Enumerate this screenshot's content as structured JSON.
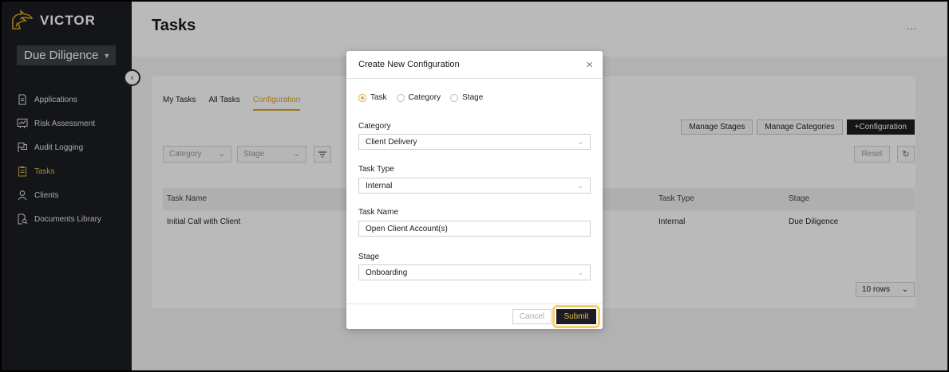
{
  "app": {
    "name": "VICTOR",
    "org_selector": "Due Diligence"
  },
  "sidebar": {
    "items": [
      {
        "label": "Applications",
        "icon": "document-icon",
        "active": false
      },
      {
        "label": "Risk Assessment",
        "icon": "chart-board-icon",
        "active": false
      },
      {
        "label": "Audit Logging",
        "icon": "audit-flag-icon",
        "active": false
      },
      {
        "label": "Tasks",
        "icon": "clipboard-icon",
        "active": true
      },
      {
        "label": "Clients",
        "icon": "user-icon",
        "active": false
      },
      {
        "label": "Documents Library",
        "icon": "document-search-icon",
        "active": false
      }
    ]
  },
  "header": {
    "title": "Tasks",
    "more": "..."
  },
  "tabs": [
    "My Tasks",
    "All Tasks",
    "Configuration"
  ],
  "actions": {
    "manage_stages": "Manage Stages",
    "manage_categories": "Manage Categories",
    "add_configuration": "+Configuration"
  },
  "filters": {
    "category_placeholder": "Category",
    "stage_placeholder": "Stage",
    "reset": "Reset"
  },
  "table": {
    "columns": [
      "Task Name",
      "Task Type",
      "Stage"
    ],
    "rows": [
      {
        "task_name": "Initial Call with Client",
        "task_type": "Internal",
        "stage": "Due Diligence"
      }
    ],
    "rows_per_page": "10 rows"
  },
  "modal": {
    "title": "Create New Configuration",
    "radio_options": [
      "Task",
      "Category",
      "Stage"
    ],
    "selected_radio": "Task",
    "fields": {
      "category": {
        "label": "Category",
        "value": "Client Delivery"
      },
      "task_type": {
        "label": "Task Type",
        "value": "Internal"
      },
      "task_name": {
        "label": "Task Name",
        "value": "Open Client Account(s)"
      },
      "stage": {
        "label": "Stage",
        "value": "Onboarding"
      }
    },
    "cancel": "Cancel",
    "submit": "Submit"
  },
  "colors": {
    "accent": "#d8a52c",
    "sidebar_bg": "#1b1d22",
    "highlight": "#f6cf6d"
  }
}
